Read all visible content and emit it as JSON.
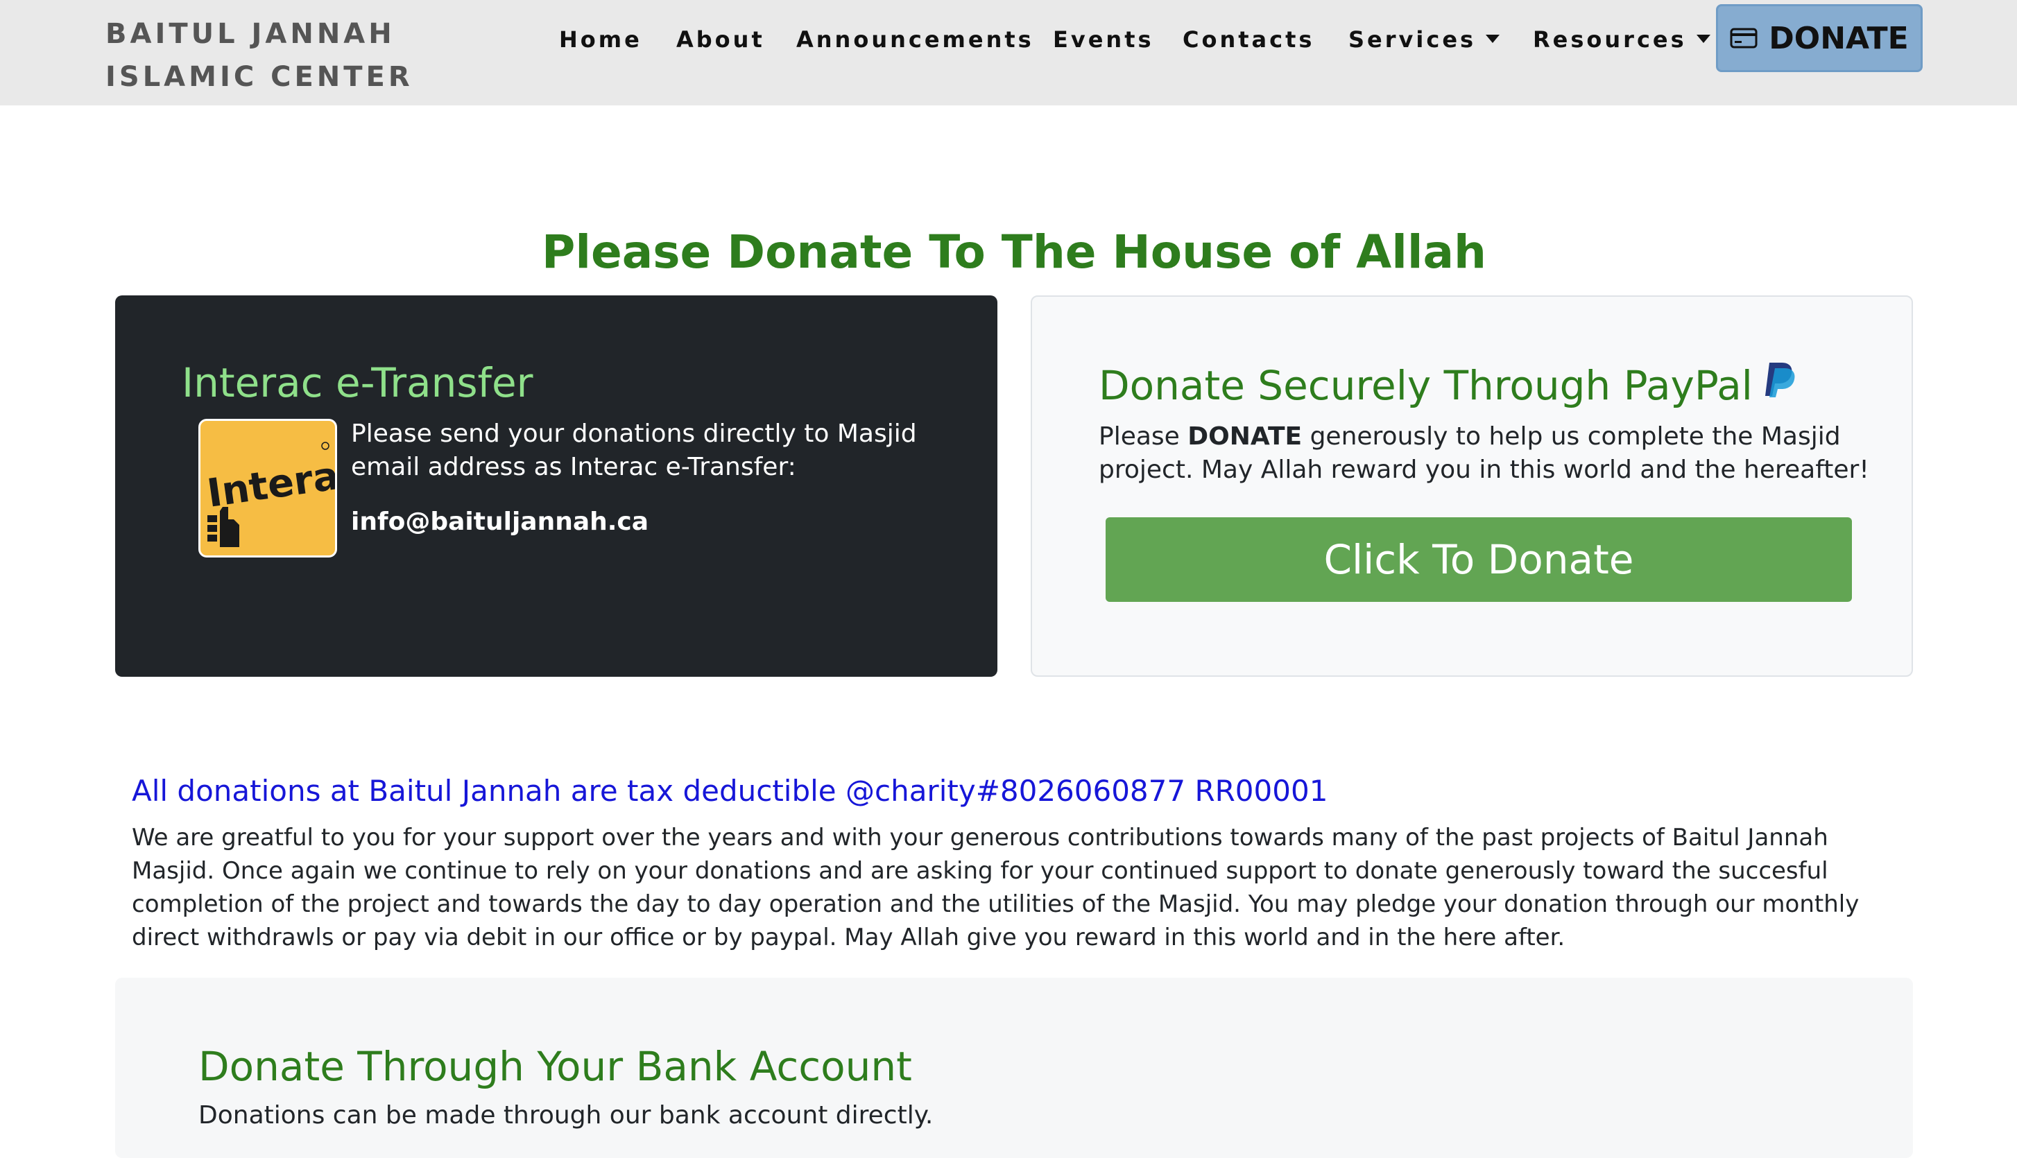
{
  "nav": {
    "brand_line1": "BAITUL JANNAH",
    "brand_line2": "ISLAMIC CENTER",
    "items": [
      {
        "label": "Home"
      },
      {
        "label": "About"
      },
      {
        "label": "Announcements"
      },
      {
        "label": "Events"
      },
      {
        "label": "Contacts"
      },
      {
        "label": "Services"
      },
      {
        "label": "Resources"
      }
    ],
    "donate_label": "DONATE"
  },
  "main": {
    "title": "Please Donate To The House of Allah"
  },
  "interac": {
    "title": "Interac e-Transfer",
    "logo_text": "Interac",
    "description": "Please send your donations directly to Masjid email address as Interac e-Transfer:",
    "email": "info@baituljannah.ca"
  },
  "paypal": {
    "title": "Donate Securely Through PayPal",
    "text_before": "Please ",
    "text_bold": "DONATE",
    "text_after": " generously to help us complete the Masjid project. May Allah reward you in this world and the hereafter!",
    "button_label": "Click To Donate"
  },
  "tax": {
    "heading": "All donations at Baitul Jannah are tax deductible @charity#8026060877 RR00001",
    "body": "We are greatful to you for your support over the years and with your generous contributions towards many of the past projects of Baitul Jannah Masjid. Once again we continue to rely on your donations and are asking for your continued support to donate generously toward the succesful completion of the project and towards the day to day operation and the utilities of the Masjid. You may pledge your donation through our monthly direct withdrawls or pay via debit in our office or by paypal. May Allah give you reward in this world and in the here after."
  },
  "bank": {
    "title": "Donate Through Your Bank Account",
    "text": "Donations can be made through our bank account directly."
  },
  "colors": {
    "green": "#2e7d1d",
    "light_green": "#8fe08a",
    "button_green": "#62a553",
    "blue_heading": "#1616d8",
    "donate_btn": "#86acd0",
    "dark_card": "#212529"
  }
}
